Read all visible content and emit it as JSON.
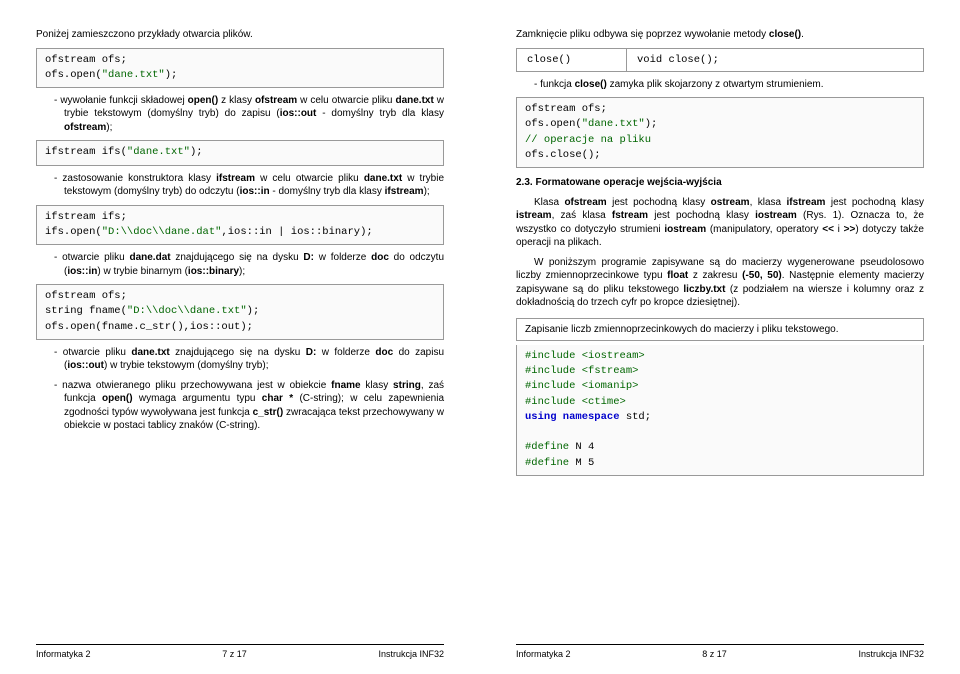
{
  "left": {
    "intro": "Poniżej zamieszczono przykłady otwarcia plików.",
    "code1_l1": "ofstream ofs;",
    "code1_l2": "ofs.open(",
    "code1_str": "\"dane.txt\"",
    "code1_l2b": ");",
    "b1": "wywołanie funkcji składowej open() z klasy ofstream w celu otwarcie pliku dane.txt w trybie tekstowym (domyślny tryb) do zapisu (ios::out - domyślny tryb dla klasy ofstream);",
    "code2_a": "ifstream ifs(",
    "code2_str": "\"dane.txt\"",
    "code2_b": ");",
    "b2": "zastosowanie konstruktora klasy ifstream w celu otwarcie pliku dane.txt w trybie tekstowym (domyślny tryb) do odczytu (ios::in - domyślny tryb dla klasy ifstream);",
    "code3_l1": "ifstream ifs;",
    "code3_l2a": "ifs.open(",
    "code3_str": "\"D:\\\\doc\\\\dane.dat\"",
    "code3_l2b": ",ios::in | ios::binary);",
    "b3": "otwarcie pliku dane.dat znajdującego się na dysku D: w folderze doc do odczytu (ios::in) w trybie binarnym (ios::binary);",
    "code4_l1": "ofstream ofs;",
    "code4_l2a": "string fname(",
    "code4_str": "\"D:\\\\doc\\\\dane.txt\"",
    "code4_l2b": ");",
    "code4_l3": "ofs.open(fname.c_str(),ios::out);",
    "b4": "otwarcie pliku dane.txt znajdującego się na dysku D: w folderze doc do zapisu (ios::out) w trybie tekstowym (domyślny tryb);",
    "b5": "nazwa otwieranego pliku przechowywana jest w obiekcie fname klasy string, zaś funkcja open() wymaga argumentu typu char * (C-string); w celu zapewnienia zgodności typów wywoływana jest funkcja c_str() zwracająca tekst przechowywany w obiekcie w postaci tablicy znaków (C-string).",
    "footer_l": "Informatyka 2",
    "footer_c": "7 z 17",
    "footer_r": "Instrukcja INF32"
  },
  "right": {
    "intro": "Zamknięcie pliku odbywa się poprzez wywołanie metody close().",
    "tbl_c1": "close()",
    "tbl_kw": "void",
    "tbl_c2": " close();",
    "b1": "funkcja close() zamyka plik skojarzony z otwartym strumieniem.",
    "code1_l1": "ofstream ofs;",
    "code1_l2a": "ofs.open(",
    "code1_str": "\"dane.txt\"",
    "code1_l2b": ");",
    "code1_l3": "// operacje na pliku",
    "code1_l4": "ofs.close();",
    "sec": "2.3. Formatowane operacje wejścia-wyjścia",
    "p1": "Klasa ofstream jest pochodną klasy ostream, klasa ifstream jest pochodną klasy istream, zaś klasa fstream jest pochodną klasy iostream (Rys. 1). Oznacza to, że wszystko co dotyczyło strumieni iostream (manipulatory, operatory << i >>) dotyczy także operacji na plikach.",
    "p2": "W poniższym programie zapisywane są do macierzy wygenerowane pseudolosowo liczby zmiennoprzecinkowe typu float z zakresu (-50, 50). Następnie elementy macierzy zapisywane są do pliku tekstowego liczby.txt (z podziałem na wiersze i kolumny oraz z dokładnością do trzech cyfr po kropce dziesiętnej).",
    "caption": "Zapisanie liczb zmiennoprzecinkowych do macierzy i pliku tekstowego.",
    "code2_inc1a": "#include ",
    "code2_inc1b": "<iostream>",
    "code2_inc2a": "#include ",
    "code2_inc2b": "<fstream>",
    "code2_inc3a": "#include ",
    "code2_inc3b": "<iomanip>",
    "code2_inc4a": "#include ",
    "code2_inc4b": "<ctime>",
    "code2_ns_a": "using namespace ",
    "code2_ns_b": "std",
    "code2_ns_c": ";",
    "code2_def1a": "#define ",
    "code2_def1b": "N 4",
    "code2_def2a": "#define ",
    "code2_def2b": "M 5",
    "footer_l": "Informatyka 2",
    "footer_c": "8 z 17",
    "footer_r": "Instrukcja INF32"
  }
}
